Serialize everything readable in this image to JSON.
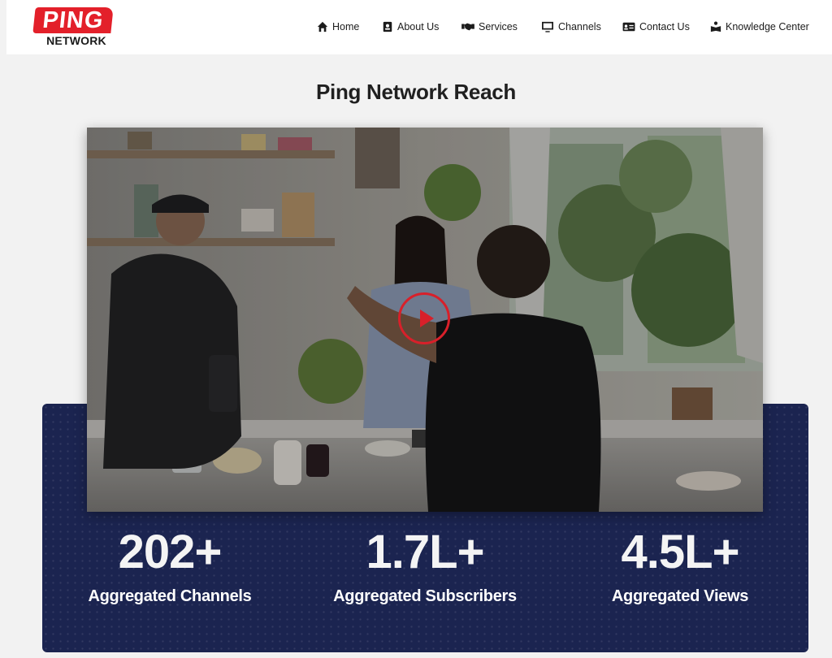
{
  "brand": {
    "logo_top": "PING",
    "logo_bottom": "NETWORK"
  },
  "nav": {
    "items": [
      {
        "label": "Home",
        "icon": "home-icon"
      },
      {
        "label": "About Us",
        "icon": "id-badge-icon"
      },
      {
        "label": "Services",
        "icon": "handshake-icon"
      },
      {
        "label": "Channels",
        "icon": "monitor-icon"
      },
      {
        "label": "Contact Us",
        "icon": "contact-card-icon"
      },
      {
        "label": "Knowledge Center",
        "icon": "reader-icon"
      }
    ]
  },
  "main": {
    "title": "Ping Network Reach",
    "video": {
      "play_icon": "play-icon"
    },
    "stats": [
      {
        "value": "202+",
        "label": "Aggregated Channels"
      },
      {
        "value": "1.7L+",
        "label": "Aggregated Subscribers"
      },
      {
        "value": "4.5L+",
        "label": "Aggregated Views"
      }
    ]
  },
  "colors": {
    "brand_red": "#e3202a",
    "panel_navy": "#1b2450",
    "page_bg": "#f2f2f2"
  }
}
